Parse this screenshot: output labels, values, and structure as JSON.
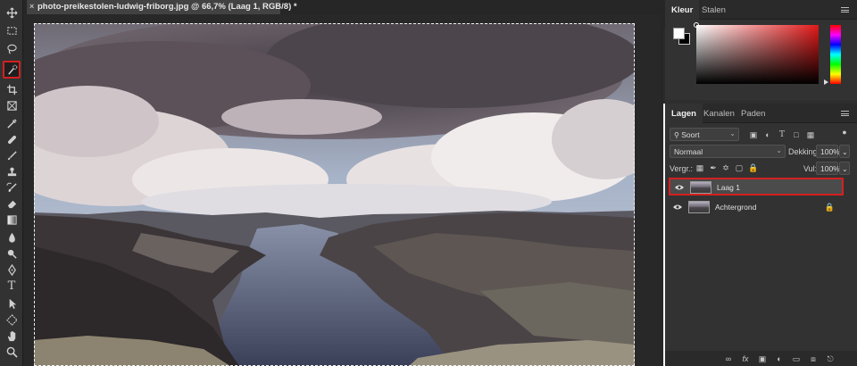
{
  "document": {
    "tab_title": "photo-preikestolen-ludwig-friborg.jpg @ 66,7% (Laag 1, RGB/8) *",
    "close_glyph": "×"
  },
  "toolbar": {
    "tools": [
      {
        "name": "move-tool",
        "icon": "move-icon"
      },
      {
        "name": "rectangular-marquee-tool",
        "icon": "marquee-icon"
      },
      {
        "name": "lasso-tool",
        "icon": "lasso-icon"
      },
      {
        "name": "quick-selection-tool",
        "icon": "quick-selection-icon",
        "selected": true
      },
      {
        "name": "crop-tool",
        "icon": "crop-icon"
      },
      {
        "name": "frame-tool",
        "icon": "frame-icon"
      },
      {
        "name": "eyedropper-tool",
        "icon": "eyedropper-icon"
      },
      {
        "name": "healing-brush-tool",
        "icon": "bandage-icon"
      },
      {
        "name": "brush-tool",
        "icon": "brush-icon"
      },
      {
        "name": "clone-stamp-tool",
        "icon": "stamp-icon"
      },
      {
        "name": "history-brush-tool",
        "icon": "history-brush-icon"
      },
      {
        "name": "eraser-tool",
        "icon": "eraser-icon"
      },
      {
        "name": "gradient-tool",
        "icon": "gradient-icon"
      },
      {
        "name": "blur-tool",
        "icon": "drop-icon"
      },
      {
        "name": "dodge-tool",
        "icon": "dodge-icon"
      },
      {
        "name": "pen-tool",
        "icon": "pen-icon"
      },
      {
        "name": "type-tool",
        "icon": "type-icon",
        "glyph": "T"
      },
      {
        "name": "path-selection-tool",
        "icon": "arrow-icon"
      },
      {
        "name": "shape-tool",
        "icon": "shape-icon"
      },
      {
        "name": "hand-tool",
        "icon": "hand-icon"
      },
      {
        "name": "zoom-tool",
        "icon": "zoom-icon"
      }
    ]
  },
  "color_panel": {
    "tabs": [
      "Kleur",
      "Stalen"
    ],
    "foreground": "#ffffff",
    "background": "#000000",
    "hue": "#e31919"
  },
  "layers_panel": {
    "tabs": [
      "Lagen",
      "Kanalen",
      "Paden"
    ],
    "filter_label": "Soort",
    "blend_mode": "Normaal",
    "opacity_label": "Dekking:",
    "opacity_value": "100%",
    "lock_label": "Vergr.:",
    "fill_label": "Vul:",
    "fill_value": "100%",
    "layers": [
      {
        "name": "Laag 1",
        "selected": true,
        "locked": false
      },
      {
        "name": "Achtergrond",
        "selected": false,
        "locked": true
      }
    ],
    "bottom_icons": [
      "link-icon",
      "fx-icon",
      "mask-icon",
      "adjustment-icon",
      "folder-icon",
      "new-layer-icon",
      "trash-icon"
    ],
    "fx_glyph": "fx"
  }
}
